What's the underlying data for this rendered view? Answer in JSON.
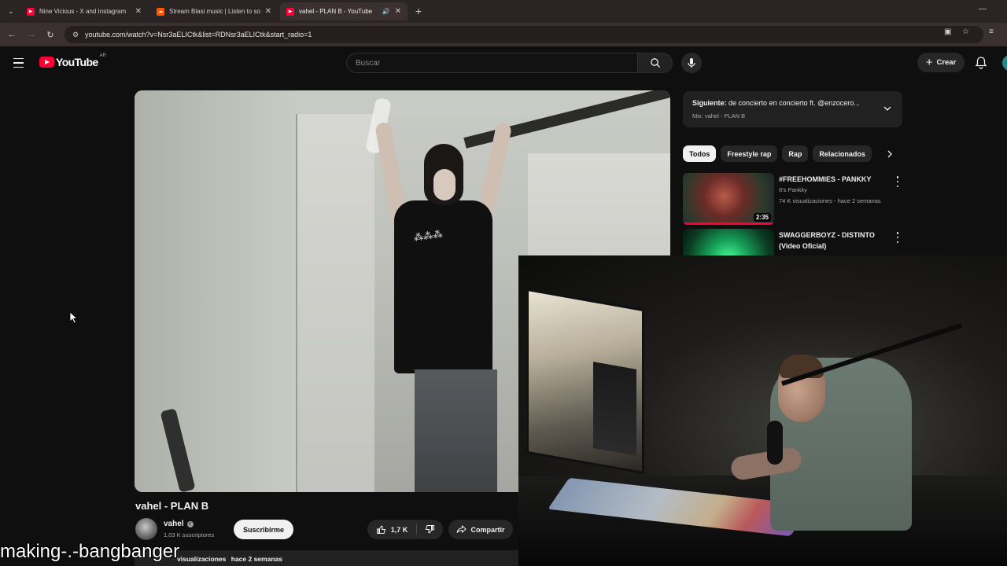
{
  "browser": {
    "tabs": [
      {
        "title": "Nine Vicious - X and Instagram",
        "favicon_color": "#ff0033",
        "active": false
      },
      {
        "title": "Stream Blasi music | Listen to so",
        "favicon_color": "#ff5500",
        "active": false
      },
      {
        "title": "vahel - PLAN B - YouTube",
        "favicon_color": "#ff0033",
        "active": true
      }
    ],
    "url": "youtube.com/watch?v=Nsr3aELICtk&list=RDNsr3aELICtk&start_radio=1"
  },
  "masthead": {
    "logo_text": "YouTube",
    "country_code": "AR",
    "search_placeholder": "Buscar",
    "create_label": "Crear"
  },
  "up_next": {
    "label": "Siguiente:",
    "title": "de concierto en concierto ft. @enzocero...",
    "mix": "Mix: vahel - PLAN B"
  },
  "chips": [
    "Todos",
    "Freestyle rap",
    "Rap",
    "Relacionados"
  ],
  "recommendations": [
    {
      "title": "#FREEHOMMIES - PANKKY",
      "channel": "It's Pankky",
      "meta": "74 K visualizaciones - hace 2 semanas",
      "duration": "2:35"
    },
    {
      "title": "SWAGGERBOYZ - DISTINTO (Video Oficial)",
      "channel": "",
      "meta": "",
      "duration": ""
    }
  ],
  "video": {
    "title": "vahel - PLAN B",
    "channel": "vahel",
    "subscribers": "1,03 K suscriptores",
    "subscribe_label": "Suscribirme",
    "likes": "1,7 K",
    "share_label": "Compartir",
    "date": "hace 2 semanas",
    "views": "visualizaciones"
  },
  "overlay": {
    "caption": "making-.-bangbanger"
  }
}
